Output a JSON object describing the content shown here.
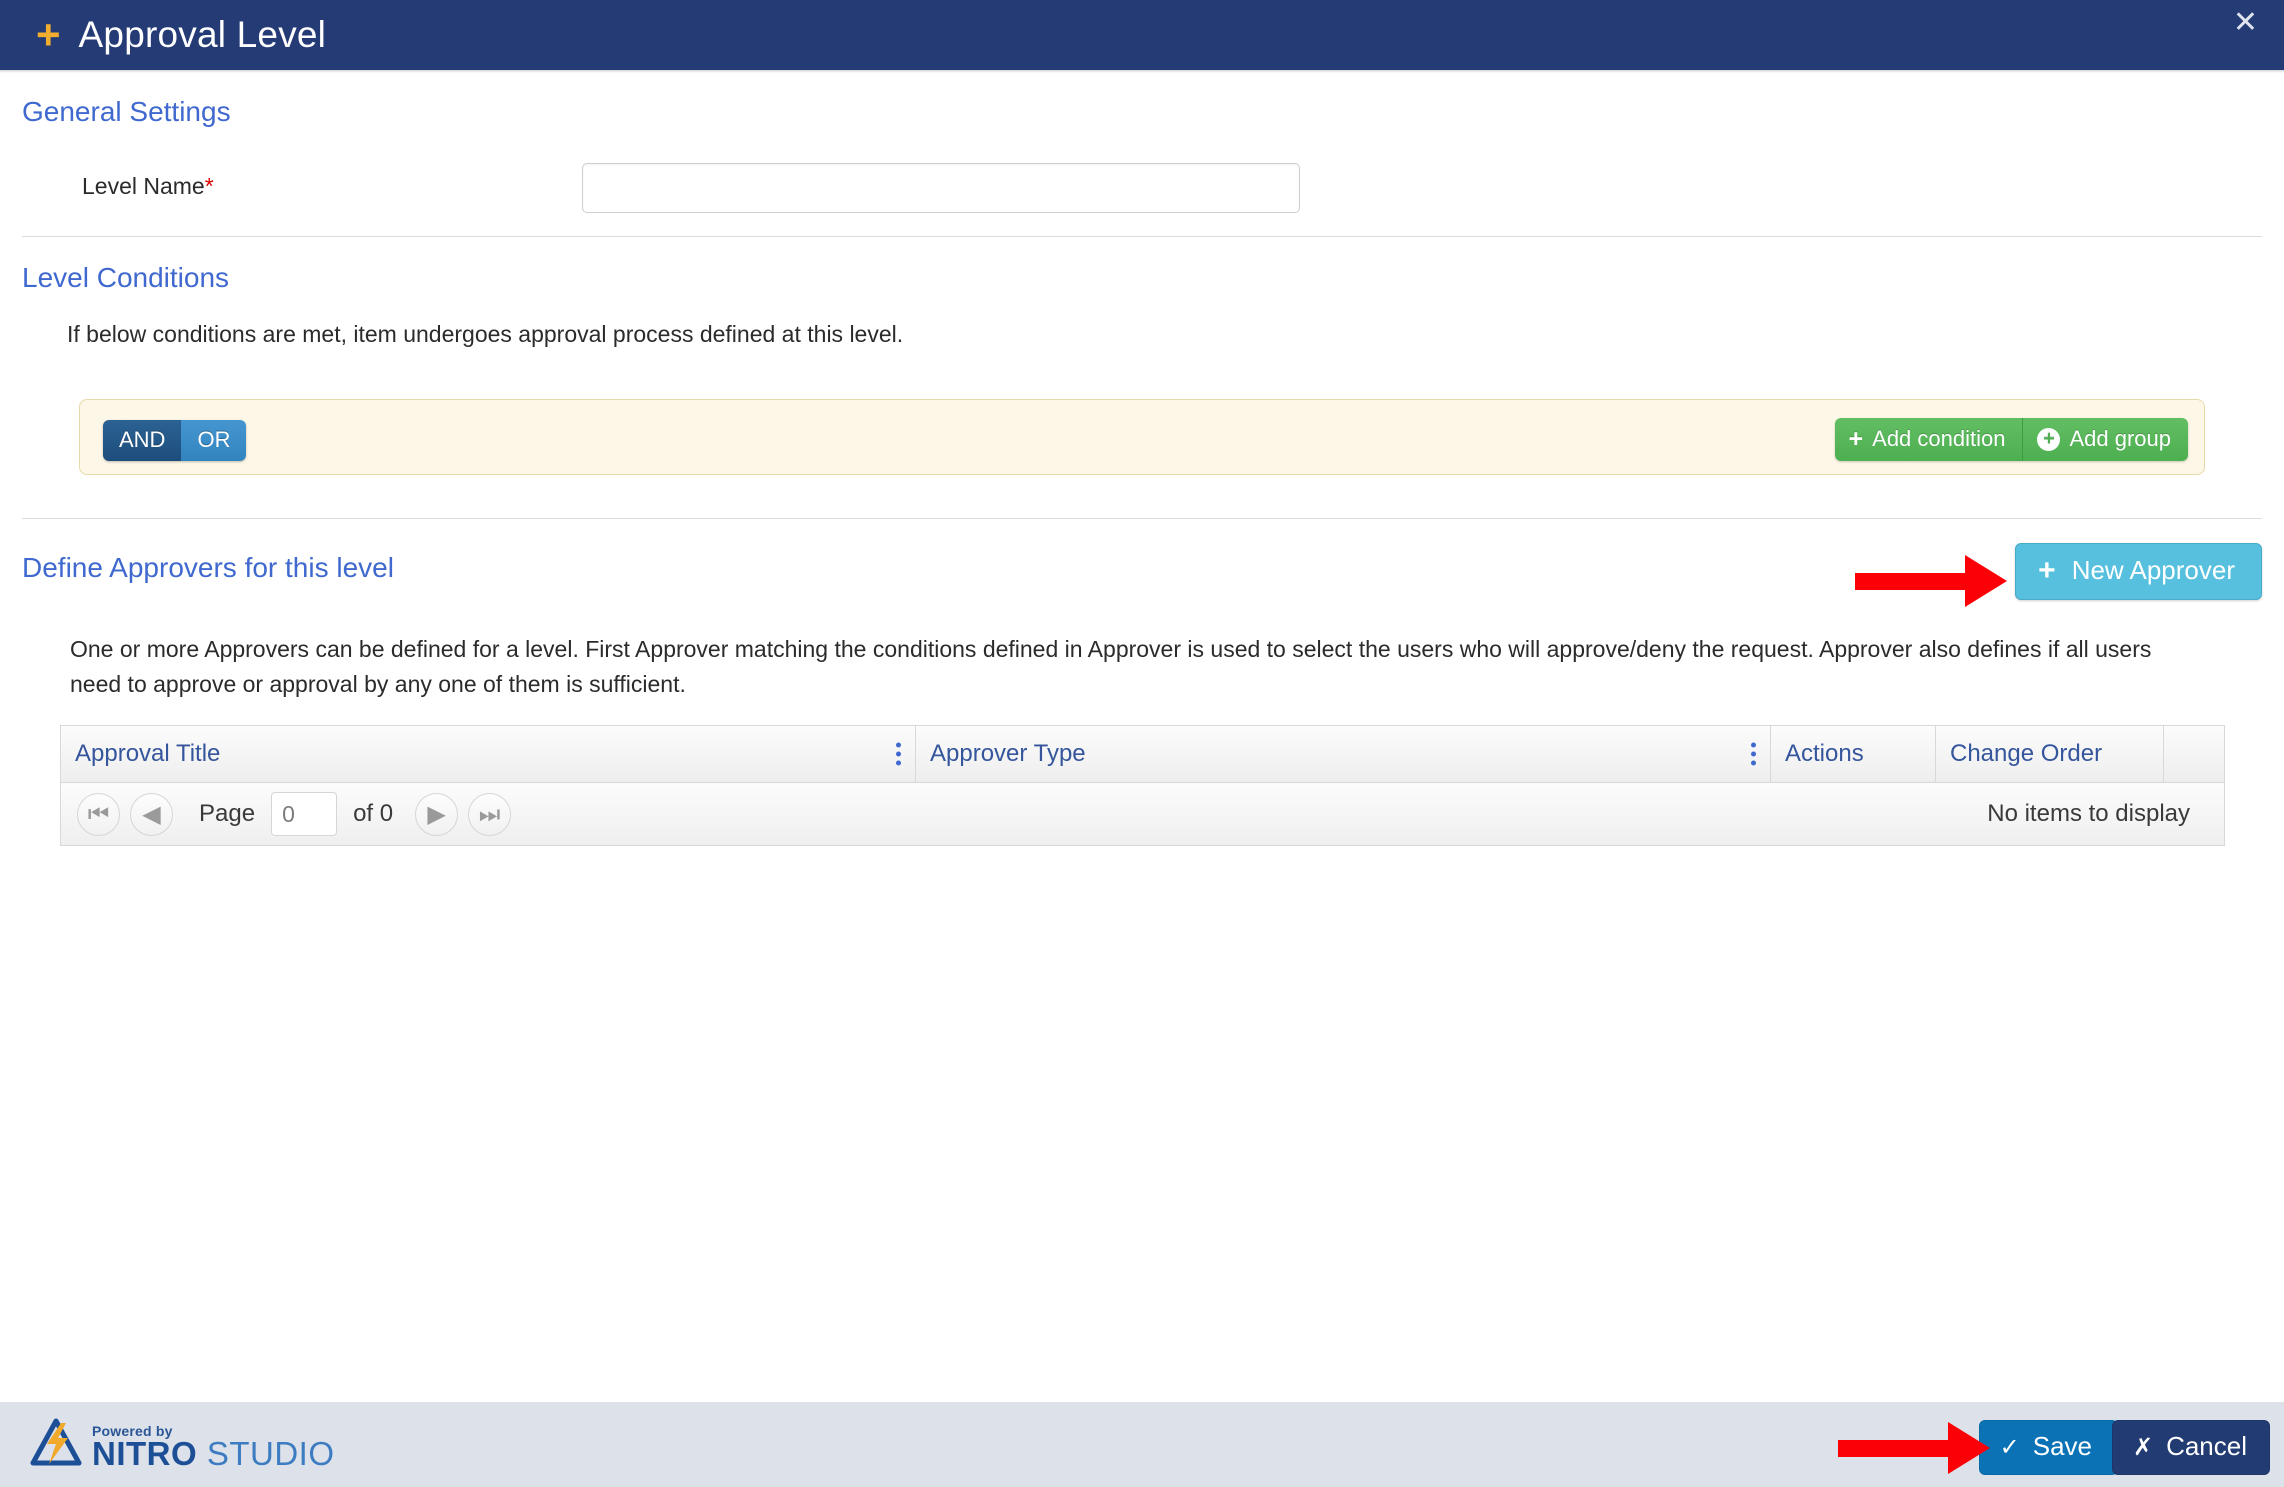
{
  "titlebar": {
    "plus_icon": "plus-icon",
    "title": "Approval Level",
    "close_label": "✕"
  },
  "general_settings": {
    "heading": "General Settings",
    "level_name_label": "Level Name",
    "required_marker": "*",
    "level_name_value": "",
    "level_name_placeholder": ""
  },
  "level_conditions": {
    "heading": "Level Conditions",
    "help_text": "If below conditions are met, item undergoes approval process defined at this level.",
    "and_label": "AND",
    "or_label": "OR",
    "active_operator": "AND",
    "add_condition_label": "Add condition",
    "add_group_label": "Add group",
    "box_background": "#fdf7e7",
    "box_border": "#e6d9ab",
    "add_button_color": "#4caf50"
  },
  "approvers": {
    "heading": "Define Approvers for this level",
    "new_approver_label": "New Approver",
    "new_approver_color": "#56c0de",
    "help_text": "One or more Approvers can be defined for a level. First Approver matching the conditions defined in Approver is used to select the users who will approve/deny the request. Approver also defines if all users need to approve or approval by any one of them is sufficient.",
    "grid": {
      "columns": [
        "Approval Title",
        "Approver Type",
        "Actions",
        "Change Order"
      ],
      "rows": [],
      "empty_message": "No items to display",
      "pager": {
        "first_label": "⏮",
        "prev_label": "◀",
        "page_label": "Page",
        "page_value": "0",
        "of_label": "of 0",
        "next_label": "▶",
        "last_label": "⏭"
      }
    }
  },
  "footer": {
    "logo_powered_by": "Powered by",
    "logo_nitro": "NITRO",
    "logo_studio": "STUDIO",
    "save_label": "Save",
    "save_icon": "check-icon",
    "save_color": "#0a72b5",
    "cancel_label": "Cancel",
    "cancel_icon": "close-icon",
    "cancel_color": "#223b73",
    "background": "#dce1ea"
  },
  "annotations": {
    "arrow_color": "#fb0007",
    "arrow_new_approver": "arrow pointing to New Approver button",
    "arrow_save": "arrow pointing to Save button"
  }
}
